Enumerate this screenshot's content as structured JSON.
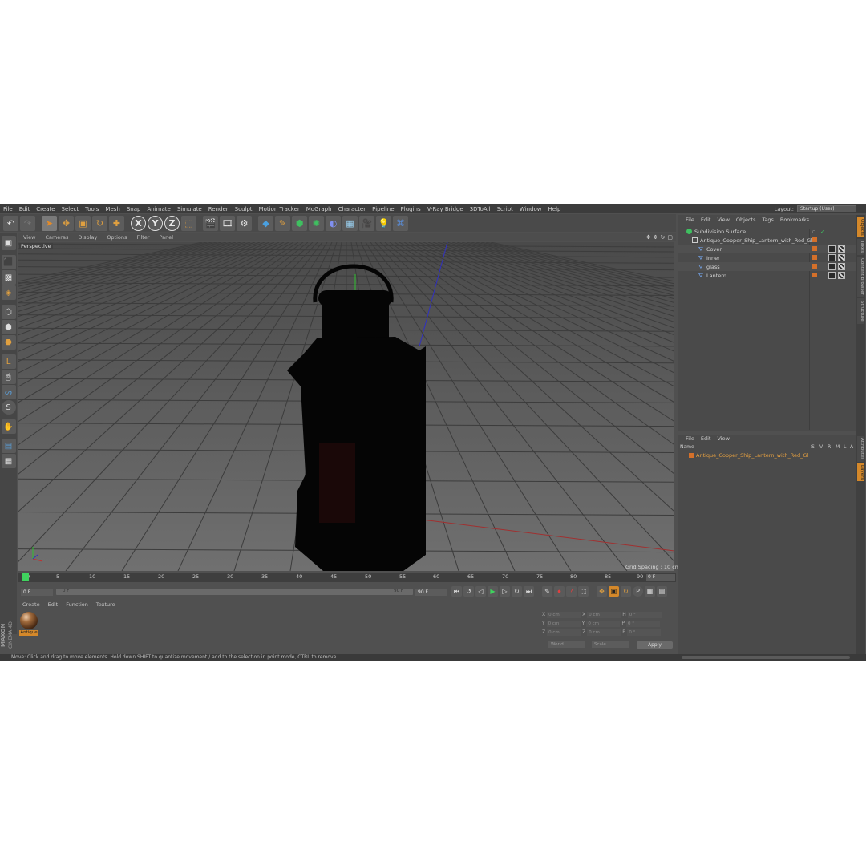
{
  "menubar": {
    "items": [
      "File",
      "Edit",
      "Create",
      "Select",
      "Tools",
      "Mesh",
      "Snap",
      "Animate",
      "Simulate",
      "Render",
      "Sculpt",
      "Motion Tracker",
      "MoGraph",
      "Character",
      "Pipeline",
      "Plugins",
      "V-Ray Bridge",
      "3DToAll",
      "Script",
      "Window",
      "Help"
    ],
    "layout_label": "Layout:",
    "layout_value": "Startup (User)"
  },
  "toolbar": {
    "icons": [
      "undo-icon",
      "redo-icon",
      "select-arrow-icon",
      "move-icon",
      "scale-icon",
      "rotate-icon",
      "live-select-icon",
      "x-axis-icon",
      "y-axis-icon",
      "z-axis-icon",
      "coordinate-system-icon",
      "render-region-icon",
      "render-view-icon",
      "render-settings-icon",
      "cube-icon",
      "pen-icon",
      "subdivision-icon",
      "array-icon",
      "deformer-icon",
      "floor-icon",
      "camera-icon",
      "light-icon",
      "python-icon"
    ],
    "x_label": "X",
    "y_label": "Y",
    "z_label": "Z"
  },
  "viewport": {
    "menu": [
      "View",
      "Cameras",
      "Display",
      "Options",
      "Filter",
      "Panel"
    ],
    "label": "Perspective",
    "grid_spacing": "Grid Spacing : 10 cm"
  },
  "timeline": {
    "ticks": [
      "0",
      "5",
      "10",
      "15",
      "20",
      "25",
      "30",
      "35",
      "40",
      "45",
      "50",
      "55",
      "60",
      "65",
      "70",
      "75",
      "80",
      "85",
      "90"
    ],
    "end_frame": "0 F",
    "start_field": "0 F",
    "range_start": "0 F",
    "range_end": "90 F",
    "end_field": "90 F"
  },
  "material_manager": {
    "menu": [
      "Create",
      "Edit",
      "Function",
      "Texture"
    ],
    "material_name": "Antique"
  },
  "coordinates": {
    "rows": [
      {
        "a": "X",
        "av": "0 cm",
        "b": "X",
        "bv": "0 cm",
        "c": "H",
        "cv": "0 °"
      },
      {
        "a": "Y",
        "av": "0 cm",
        "b": "Y",
        "bv": "0 cm",
        "c": "P",
        "cv": "0 °"
      },
      {
        "a": "Z",
        "av": "0 cm",
        "b": "Z",
        "bv": "0 cm",
        "c": "B",
        "cv": "0 °"
      }
    ],
    "mode1": "World",
    "mode2": "Scale",
    "apply": "Apply"
  },
  "object_manager": {
    "menu": [
      "File",
      "Edit",
      "View",
      "Objects",
      "Tags",
      "Bookmarks"
    ],
    "objects": [
      {
        "name": "Subdivision Surface",
        "level": 0
      },
      {
        "name": "Antique_Copper_Ship_Lantern_with_Red_Glass",
        "level": 1
      },
      {
        "name": "Cover",
        "level": 2
      },
      {
        "name": "Inner",
        "level": 2
      },
      {
        "name": "glass",
        "level": 2
      },
      {
        "name": "Lantern",
        "level": 2
      }
    ]
  },
  "layer_manager": {
    "menu": [
      "File",
      "Edit",
      "View"
    ],
    "col_name": "Name",
    "cols": [
      "S",
      "V",
      "R",
      "M",
      "L",
      "A"
    ],
    "row": "Antique_Copper_Ship_Lantern_with_Red_Glass"
  },
  "side_tabs": [
    "Objects",
    "Takes",
    "Content Browser",
    "Structure",
    "Attributes",
    "Layers"
  ],
  "logo": {
    "line1": "MAXON",
    "line2": "CINEMA 4D"
  },
  "status": "Move: Click and drag to move elements. Hold down SHIFT to quantize movement / add to the selection in point mode, CTRL to remove.",
  "colors": {
    "accent": "#d4882a",
    "play": "#3fd35e",
    "bg": "#505050"
  }
}
